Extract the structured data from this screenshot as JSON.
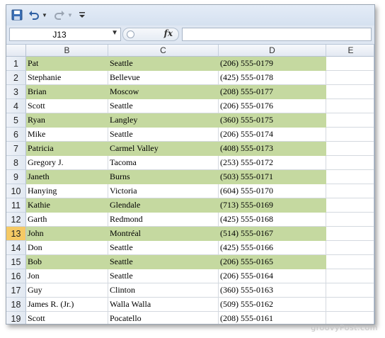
{
  "quick_access": {
    "icons": [
      "save-icon",
      "undo-icon",
      "redo-icon",
      "customize-qat-icon"
    ]
  },
  "formula_bar": {
    "name_box": "J13",
    "fx_label": "fx",
    "formula_value": ""
  },
  "columns": [
    "B",
    "C",
    "D",
    "E"
  ],
  "selected_row": "13",
  "rows": [
    {
      "num": "1",
      "b": "Pat",
      "c": "Seattle",
      "d": "(206) 555-0179",
      "hl": true
    },
    {
      "num": "2",
      "b": "Stephanie",
      "c": "Bellevue",
      "d": "(425) 555-0178",
      "hl": false
    },
    {
      "num": "3",
      "b": "Brian",
      "c": "Moscow",
      "d": "(208) 555-0177",
      "hl": true
    },
    {
      "num": "4",
      "b": "Scott",
      "c": "Seattle",
      "d": "(206) 555-0176",
      "hl": false
    },
    {
      "num": "5",
      "b": "Ryan",
      "c": "Langley",
      "d": "(360) 555-0175",
      "hl": true
    },
    {
      "num": "6",
      "b": "Mike",
      "c": "Seattle",
      "d": "(206) 555-0174",
      "hl": false
    },
    {
      "num": "7",
      "b": "Patricia",
      "c": "Carmel Valley",
      "d": "(408) 555-0173",
      "hl": true
    },
    {
      "num": "8",
      "b": "Gregory J.",
      "c": "Tacoma",
      "d": "(253) 555-0172",
      "hl": false
    },
    {
      "num": "9",
      "b": "Janeth",
      "c": "Burns",
      "d": "(503) 555-0171",
      "hl": true
    },
    {
      "num": "10",
      "b": "Hanying",
      "c": "Victoria",
      "d": "(604) 555-0170",
      "hl": false
    },
    {
      "num": "11",
      "b": "Kathie",
      "c": "Glendale",
      "d": "(713) 555-0169",
      "hl": true
    },
    {
      "num": "12",
      "b": "Garth",
      "c": "Redmond",
      "d": "(425) 555-0168",
      "hl": false
    },
    {
      "num": "13",
      "b": "John",
      "c": "Montréal",
      "d": "(514) 555-0167",
      "hl": true
    },
    {
      "num": "14",
      "b": "Don",
      "c": "Seattle",
      "d": "(425) 555-0166",
      "hl": false
    },
    {
      "num": "15",
      "b": "Bob",
      "c": "Seattle",
      "d": "(206) 555-0165",
      "hl": true
    },
    {
      "num": "16",
      "b": "Jon",
      "c": "Seattle",
      "d": "(206) 555-0164",
      "hl": false
    },
    {
      "num": "17",
      "b": "Guy",
      "c": "Clinton",
      "d": "(360) 555-0163",
      "hl": false
    },
    {
      "num": "18",
      "b": "James R. (Jr.)",
      "c": "Walla Walla",
      "d": "(509) 555-0162",
      "hl": false
    },
    {
      "num": "19",
      "b": "Scott",
      "c": "Pocatello",
      "d": "(208) 555-0161",
      "hl": false
    }
  ],
  "colors": {
    "highlight": "#c5d9a0",
    "selected_row_header": "#f5c965"
  },
  "watermark": "groovyPost.com"
}
